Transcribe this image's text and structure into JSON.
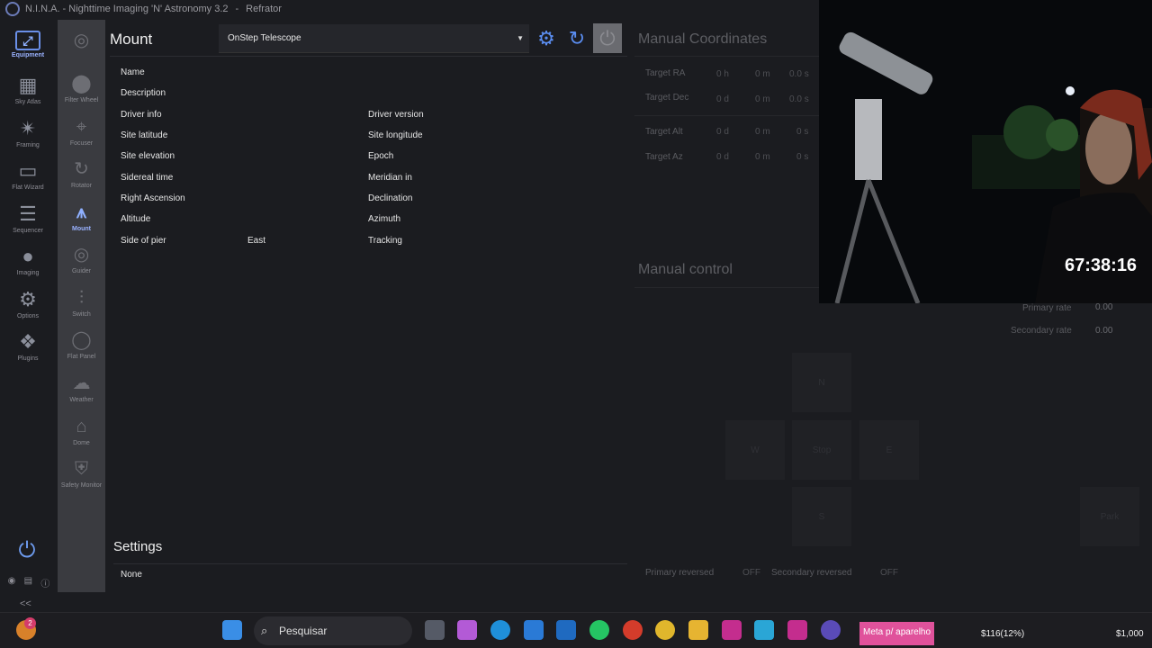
{
  "window": {
    "app_title": "N.I.N.A. - Nighttime Imaging 'N' Astronomy 3.2",
    "separator": "-",
    "profile": "Refrator"
  },
  "nav": {
    "items": [
      {
        "label": "Equipment",
        "icon": "laptop-icon"
      },
      {
        "label": "Sky Atlas",
        "icon": "map-icon"
      },
      {
        "label": "Framing",
        "icon": "stars-icon"
      },
      {
        "label": "Flat Wizard",
        "icon": "flat-wizard-icon"
      },
      {
        "label": "Sequencer",
        "icon": "sequencer-icon"
      },
      {
        "label": "Imaging",
        "icon": "imaging-icon"
      },
      {
        "label": "Options",
        "icon": "gears-icon"
      },
      {
        "label": "Plugins",
        "icon": "puzzle-icon"
      }
    ],
    "collapse": "<<"
  },
  "subnav": {
    "items": [
      {
        "label": "",
        "icon": "camera-aperture-icon"
      },
      {
        "label": "Filter Wheel",
        "icon": "filter-wheel-icon"
      },
      {
        "label": "Focuser",
        "icon": "focuser-icon"
      },
      {
        "label": "Rotator",
        "icon": "rotator-icon"
      },
      {
        "label": "Mount",
        "icon": "telescope-icon"
      },
      {
        "label": "Guider",
        "icon": "guider-icon"
      },
      {
        "label": "Switch",
        "icon": "switch-icon"
      },
      {
        "label": "Flat Panel",
        "icon": "lightbulb-icon"
      },
      {
        "label": "Weather",
        "icon": "cloud-icon"
      },
      {
        "label": "Dome",
        "icon": "dome-icon"
      },
      {
        "label": "Safety Monitor",
        "icon": "shield-icon"
      }
    ]
  },
  "mount": {
    "title": "Mount",
    "device": "OnStep Telescope",
    "left_labels": [
      "Name",
      "Description",
      "Driver info",
      "Site latitude",
      "Site elevation",
      "Sidereal time",
      "Right Ascension",
      "Altitude",
      "Side of pier"
    ],
    "right_labels": [
      "Driver version",
      "Site longitude",
      "Epoch",
      "Meridian in",
      "Declination",
      "Azimuth",
      "Tracking"
    ],
    "side_of_pier_value": "East"
  },
  "settings": {
    "title": "Settings",
    "value": "None"
  },
  "manual_coordinates": {
    "title": "Manual Coordinates",
    "rows": [
      {
        "label": "Target RA",
        "v1": "0",
        "u1": "h",
        "v2": "0",
        "u2": "m",
        "v3": "0.0",
        "u3": "s"
      },
      {
        "label": "Target Dec",
        "v1": "0",
        "u1": "d",
        "v2": "0",
        "u2": "m",
        "v3": "0.0",
        "u3": "s"
      },
      {
        "label": "Target Alt",
        "v1": "0",
        "u1": "d",
        "v2": "0",
        "u2": "m",
        "v3": "0",
        "u3": "s"
      },
      {
        "label": "Target Az",
        "v1": "0",
        "u1": "d",
        "v2": "0",
        "u2": "m",
        "v3": "0",
        "u3": "s"
      }
    ]
  },
  "manual_control": {
    "title": "Manual control",
    "primary_rate_label": "Primary rate",
    "primary_rate_value": "0.00",
    "secondary_rate_label": "Secondary rate",
    "secondary_rate_value": "0.00",
    "north": "N",
    "west": "W",
    "stop": "Stop",
    "east": "E",
    "south": "S",
    "park": "Park",
    "primary_reversed_label": "Primary reversed",
    "primary_reversed_value": "OFF",
    "secondary_reversed_label": "Secondary reversed",
    "secondary_reversed_value": "OFF"
  },
  "overlay": {
    "timer": "67:38:16"
  },
  "taskbar": {
    "search_placeholder": "Pesquisar",
    "weather_badge": "2",
    "meta_chip": "Meta p/ aparelho",
    "donation_progress": "$116(12%)",
    "donation_goal": "$1,000"
  },
  "colors": {
    "accent": "#6a8fe8",
    "background": "#1b1c20",
    "subnav_bg": "#3a3b40",
    "chip": "#e0529b"
  }
}
